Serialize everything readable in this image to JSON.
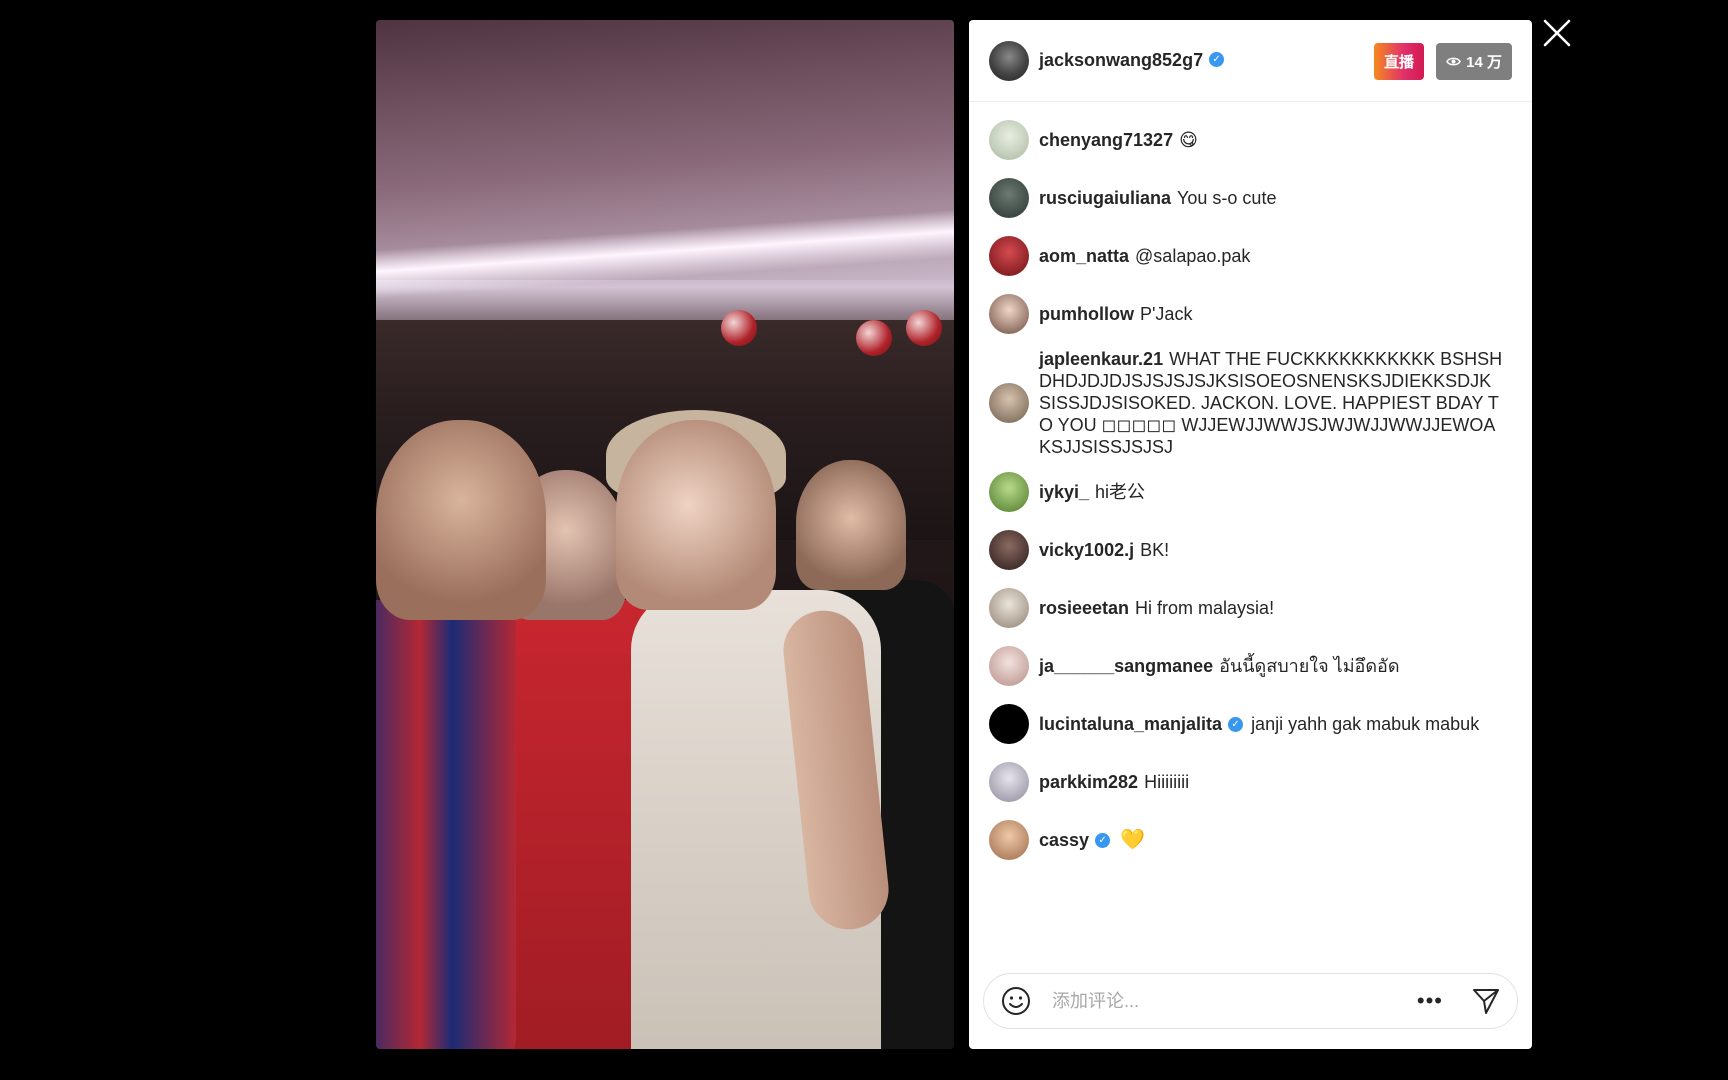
{
  "header": {
    "username": "jacksonwang852g7",
    "live_label": "直播",
    "viewer_count": "14 万"
  },
  "comments": [
    {
      "user": "chenyang71327",
      "text": "😋",
      "avatar_color": "#cfd8c8"
    },
    {
      "user": "rusciugaiuliana",
      "text": "You s-o cute",
      "avatar_color": "#3d4a45"
    },
    {
      "user": "aom_natta",
      "text": "@salapao.pak",
      "avatar_color": "#9b1e22"
    },
    {
      "user": "pumhollow",
      "text": "P'Jack",
      "avatar_color": "#6b4b3e"
    },
    {
      "user": "japleenkaur.21",
      "text": "WHAT THE FUCKKKKKKKKKKK BSHSHDHDJDJDJSJSJSJSJKSISOEOSNENSKSJDIEKKSDJK SISSJDJSISOKED. JACKON. LOVE. HAPPIEST BDAY TO YOU ◻◻◻◻◻ WJJEWJJWWJSJWJWJJWWJJEWOAKSJJSISSJSJSJ",
      "avatar_color": "#8b7a6a"
    },
    {
      "user": "iykyi_",
      "text": "hi老公",
      "avatar_color": "#7aa34e"
    },
    {
      "user": "vicky1002.j",
      "text": "BK!",
      "avatar_color": "#3b2a2a"
    },
    {
      "user": "rosieeetan",
      "text": "Hi from malaysia!",
      "avatar_color": "#b8aa9a"
    },
    {
      "user": "ja______sangmanee",
      "text": "อันนี้ดูสบายใจ ไม่อึดอัด",
      "avatar_color": "#d8b7b2"
    },
    {
      "user": "lucintaluna_manjalita",
      "text": "janji yahh gak mabuk mabuk",
      "avatar_color": "#000000",
      "verified": true
    },
    {
      "user": "parkkim282",
      "text": "Hiiiiiiii",
      "avatar_color": "#c4c2cc"
    },
    {
      "user": "cassy",
      "text": "💛",
      "avatar_color": "#c99a7a",
      "verified": true
    }
  ],
  "composer": {
    "placeholder": "添加评论..."
  },
  "colors": {
    "live_gradient_start": "#f5891f",
    "live_gradient_end": "#d31a52",
    "verified": "#3897f0",
    "viewer_badge": "#7f7f7f"
  },
  "icons": [
    "close-icon",
    "eye-icon",
    "verified-icon",
    "smile-icon",
    "more-icon",
    "send-icon"
  ]
}
